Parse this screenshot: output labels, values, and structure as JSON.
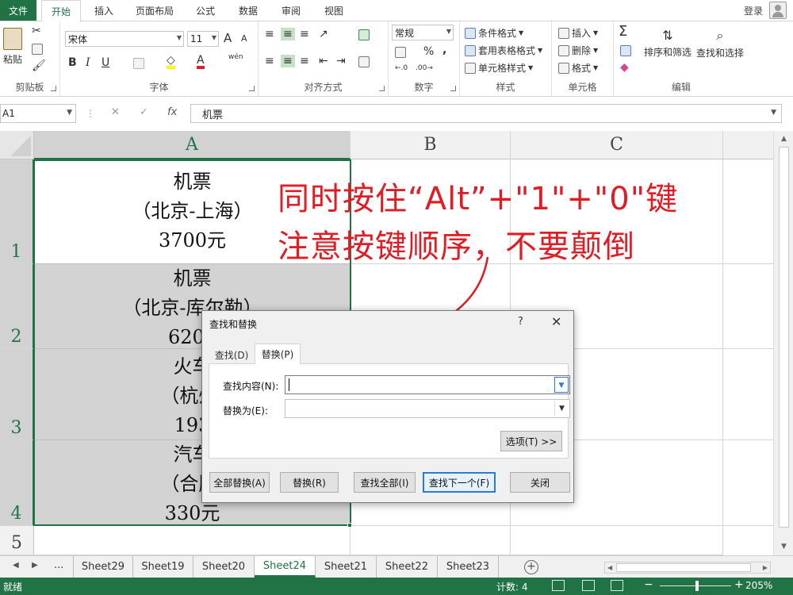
{
  "ribbon": {
    "tabs": [
      "文件",
      "开始",
      "插入",
      "页面布局",
      "公式",
      "数据",
      "审阅",
      "视图"
    ],
    "active_tab": "开始",
    "login": "登录",
    "clipboard": {
      "paste": "粘贴",
      "label": "剪贴板"
    },
    "font": {
      "name": "宋体",
      "size": "11",
      "label": "字体",
      "grow": "A",
      "shrink": "A",
      "bold": "B",
      "italic": "I",
      "underline": "U",
      "wen": "wén"
    },
    "alignment": {
      "label": "对齐方式"
    },
    "number": {
      "format": "常规",
      "label": "数字",
      "percent": "%",
      "comma": ","
    },
    "styles": {
      "conditional": "条件格式",
      "table": "套用表格格式",
      "cell": "单元格样式",
      "label": "样式"
    },
    "cells": {
      "insert": "插入",
      "delete": "删除",
      "format": "格式",
      "label": "单元格"
    },
    "editing": {
      "sort": "排序和筛选",
      "find": "查找和选择",
      "label": "编辑",
      "sigma": "Σ"
    }
  },
  "formula_bar": {
    "name_box": "A1",
    "content": "机票",
    "fx": "fx"
  },
  "grid": {
    "columns": [
      "A",
      "B",
      "C"
    ],
    "rows": [
      "1",
      "2",
      "3",
      "4",
      "5"
    ],
    "cells": [
      [
        "机票",
        "（北京-上海）",
        "3700元"
      ],
      [
        "机票",
        "（北京-库尔勒）",
        "6200"
      ],
      [
        "火车",
        "（杭州-",
        "193"
      ],
      [
        "汽车",
        "（合肥-",
        "330元"
      ]
    ]
  },
  "annotation": {
    "line1": "同时按住“Alt”+\"1\"+\"0\"键",
    "line2": "注意按键顺序，不要颠倒"
  },
  "dialog": {
    "title": "查找和替换",
    "help": "?",
    "close": "✕",
    "tabs": [
      "查找(D)",
      "替换(P)"
    ],
    "active_tab": "替换(P)",
    "find_label": "查找内容(N):",
    "find_value": "",
    "replace_label": "替换为(E):",
    "replace_value": "",
    "options_button": "选项(T) >>",
    "buttons": [
      "全部替换(A)",
      "替换(R)",
      "查找全部(I)",
      "查找下一个(F)",
      "关闭"
    ]
  },
  "sheets": {
    "tabs": [
      "Sheet29",
      "Sheet19",
      "Sheet20",
      "Sheet24",
      "Sheet21",
      "Sheet22",
      "Sheet23"
    ],
    "active": "Sheet24",
    "ellipsis": "..."
  },
  "status": {
    "ready": "就绪",
    "count": "计数: 4",
    "zoom": "205%"
  },
  "colors": {
    "excel_green": "#217346",
    "annotation_red": "#e11c24",
    "selection_gray": "#d3d3d3"
  }
}
